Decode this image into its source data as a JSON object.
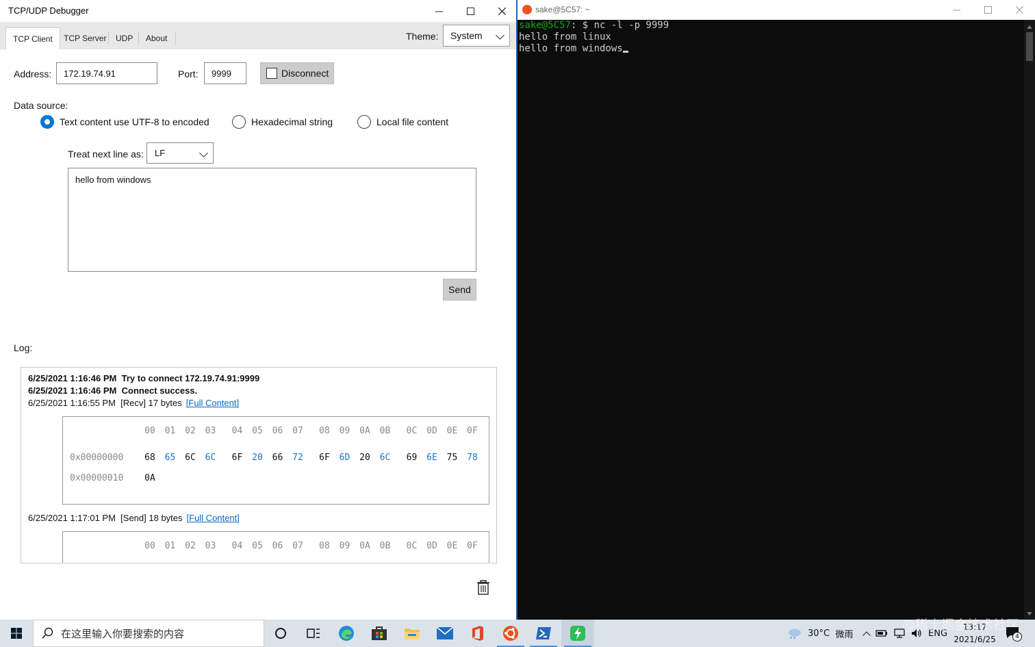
{
  "app": {
    "title": "TCP/UDP Debugger",
    "tabs": [
      {
        "label": "TCP Client"
      },
      {
        "label": "TCP Server"
      },
      {
        "label": "UDP"
      },
      {
        "label": "About"
      }
    ],
    "theme_label": "Theme:",
    "theme_value": "System",
    "address_label": "Address:",
    "address_value": "172.19.74.91",
    "port_label": "Port:",
    "port_value": "9999",
    "disconnect_label": "Disconnect",
    "data_source_label": "Data source:",
    "sources": [
      {
        "label": "Text content use UTF-8 to encoded",
        "selected": true
      },
      {
        "label": "Hexadecimal string",
        "selected": false
      },
      {
        "label": "Local file content",
        "selected": false
      }
    ],
    "next_line_label": "Treat next line as:",
    "next_line_value": "LF",
    "content_text": "hello from windows",
    "send_label": "Send",
    "log_label": "Log:",
    "log": {
      "entries": [
        {
          "time": "6/25/2021 1:16:46 PM",
          "msg": "Try to connect 172.19.74.91:9999"
        },
        {
          "time": "6/25/2021 1:16:46 PM",
          "msg": "Connect success."
        }
      ],
      "recv": {
        "time": "6/25/2021 1:16:55 PM",
        "msg": "[Recv] 17 bytes",
        "link": "[Full Content]"
      },
      "send": {
        "time": "6/25/2021 1:17:01 PM",
        "msg": "[Send] 18 bytes",
        "link": "[Full Content]"
      },
      "hex_header": [
        "00",
        "01",
        "02",
        "03",
        "04",
        "05",
        "06",
        "07",
        "08",
        "09",
        "0A",
        "0B",
        "0C",
        "0D",
        "0E",
        "0F"
      ],
      "hex_rows": [
        {
          "addr": "0x00000000",
          "bytes": [
            "68",
            "65",
            "6C",
            "6C",
            "6F",
            "20",
            "66",
            "72",
            "6F",
            "6D",
            "20",
            "6C",
            "69",
            "6E",
            "75",
            "78"
          ]
        },
        {
          "addr": "0x00000010",
          "bytes": [
            "0A"
          ]
        }
      ]
    }
  },
  "terminal": {
    "title": "sake@5C57: ~",
    "prompt_user": "sake@5C57",
    "prompt_rest": ": $ nc -l -p 9999",
    "lines": [
      "hello from linux",
      "hello from windows"
    ]
  },
  "taskbar": {
    "search_placeholder": "在这里输入你要搜索的内容",
    "weather": "30°C",
    "weather_desc": "微雨",
    "lang": "ENG",
    "time": "13:17",
    "date": "2021/6/25",
    "notification_count": "4",
    "watermark": "@稀土掘金技术社区"
  },
  "colors": {
    "accent": "#0078d4",
    "hex_blue": "#1a73c8",
    "terminal_green": "#13a10e",
    "terminal_bg": "#0c0c0c"
  }
}
